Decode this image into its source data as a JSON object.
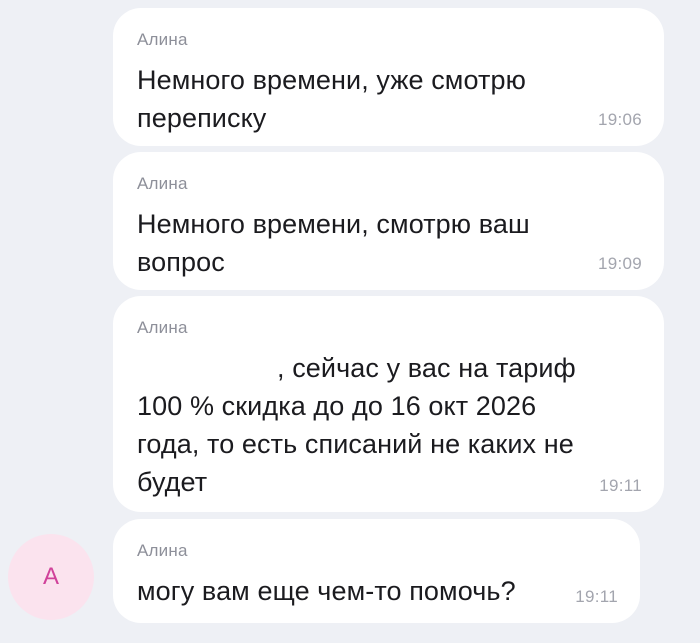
{
  "chat": {
    "messages": [
      {
        "sender": "Алина",
        "text": "Немного времени, уже смотрю переписку",
        "time": "19:06"
      },
      {
        "sender": "Алина",
        "text": "Немного времени, смотрю ваш вопрос",
        "time": "19:09"
      },
      {
        "sender": "Алина",
        "text": ", сейчас у вас на тариф 100 % скидка до до 16 окт 2026 года, то есть списаний не каких не будет",
        "time": "19:11"
      },
      {
        "sender": "Алина",
        "text": "могу вам еще чем-то помочь?",
        "time": "19:11"
      }
    ],
    "avatar_letter": "А"
  },
  "colors": {
    "background": "#eef0f5",
    "bubble": "#ffffff",
    "avatar_bg": "#fbe3ee",
    "avatar_text": "#d0429a"
  }
}
